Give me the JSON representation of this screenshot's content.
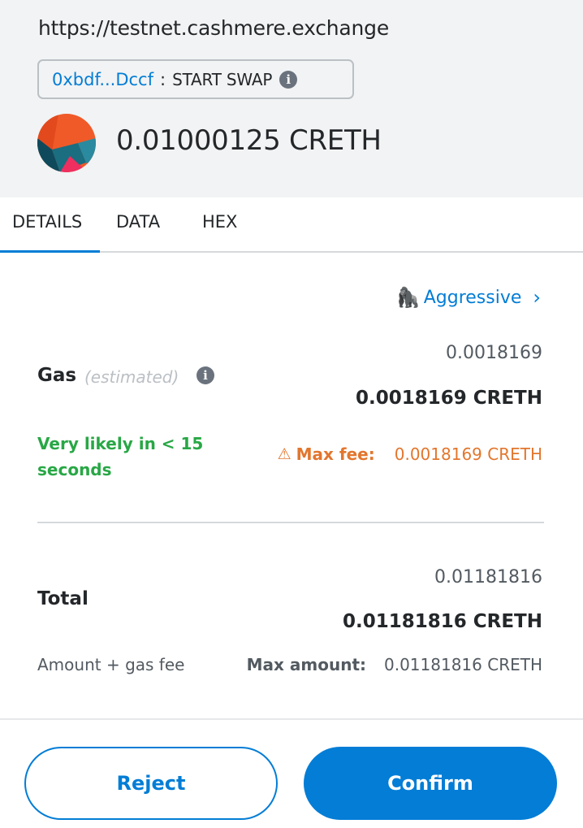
{
  "header": {
    "origin": "https://testnet.cashmere.exchange",
    "sender_address": "0xbdf...Dccf",
    "separator": ":",
    "method": "START SWAP",
    "info_glyph": "i",
    "amount": "0.01000125 CRETH"
  },
  "tabs": [
    {
      "label": "DETAILS",
      "active": true
    },
    {
      "label": "DATA",
      "active": false
    },
    {
      "label": "HEX",
      "active": false
    }
  ],
  "gas": {
    "option_icon": "🦍",
    "option_label": "Aggressive",
    "option_chevron": "›",
    "label": "Gas",
    "estimated": "(estimated)",
    "fiat_value": "0.0018169",
    "native_value": "0.0018169 CRETH",
    "likelihood": "Very likely in < 15 seconds",
    "warning_glyph": "⚠",
    "max_fee_label": "Max fee:",
    "max_fee_value": "0.0018169 CRETH"
  },
  "total": {
    "label": "Total",
    "fiat_value": "0.01181816",
    "native_value": "0.01181816 CRETH",
    "subtext": "Amount + gas fee",
    "max_amount_label": "Max amount:",
    "max_amount_value": "0.01181816 CRETH"
  },
  "actions": {
    "reject_label": "Reject",
    "confirm_label": "Confirm"
  },
  "colors": {
    "accent": "#037dd6",
    "success": "#28a745",
    "warning": "#e2762d",
    "header_bg": "#f2f3f4"
  }
}
